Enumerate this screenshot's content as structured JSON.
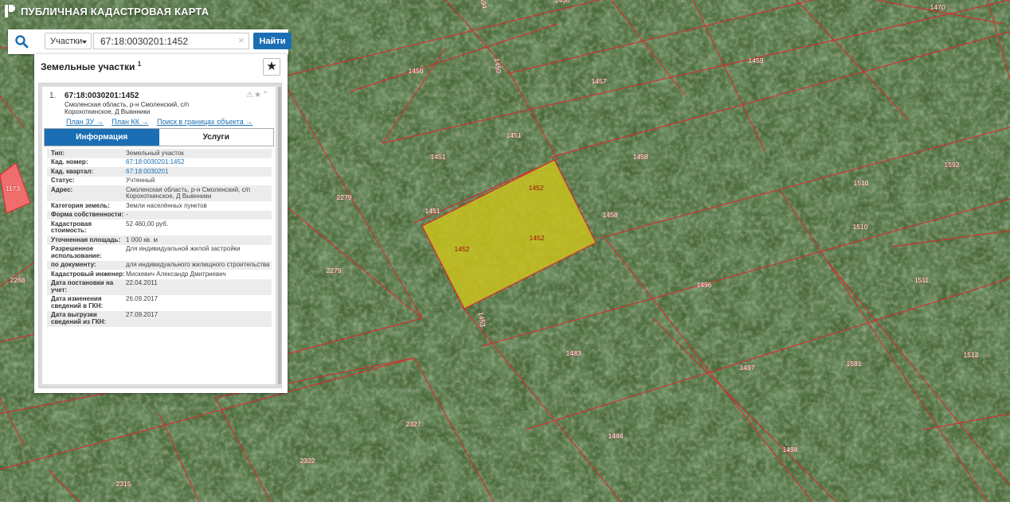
{
  "header": {
    "title": "ПУБЛИЧНАЯ КАДАСТРОВАЯ КАРТА",
    "logo_icon": "pkk-logo-icon"
  },
  "search": {
    "icon": "search-icon",
    "category": "Участки",
    "value": "67:18:0030201:1452",
    "find_label": "Найти"
  },
  "panel": {
    "title": "Земельные участки",
    "count": "1",
    "bookmark_icon": "star-icon",
    "result": {
      "index": "1.",
      "cad_number": "67:18:0030201:1452",
      "address": "Смоленская область, р-н Смоленский, с/п Корохоткинское, Д Вывнники",
      "links": [
        "План ЗУ →",
        "План КК →",
        "Поиск в границах объекта →"
      ],
      "tabs": [
        "Информация",
        "Услуги"
      ],
      "attributes": [
        {
          "key": "Тип:",
          "value": "Земельный участок"
        },
        {
          "key": "Кад. номер:",
          "value": "67:18:0030201:1452",
          "link": true
        },
        {
          "key": "Кад. квартал:",
          "value": "67:18:0030201",
          "link": true
        },
        {
          "key": "Статус:",
          "value": "Учтенный"
        },
        {
          "key": "Адрес:",
          "value": "Смоленская область, р-н Смоленский, с/п Корохоткинское, Д Вывнники"
        },
        {
          "key": "Категория земель:",
          "value": "Земли населённых пунктов"
        },
        {
          "key": "Форма собственности:",
          "value": "-"
        },
        {
          "key": "Кадастровая стоимость:",
          "value": "52 460,00 руб."
        },
        {
          "key": "Уточненная площадь:",
          "value": "1 000 кв. м"
        },
        {
          "key": "Разрешенное использование:",
          "value": "Для индивидуальной жилой застройки"
        },
        {
          "key": "по документу:",
          "value": "для индивидуального жилищного строительства"
        },
        {
          "key": "Кадастровый инженер:",
          "value": "Мискевич Александр Дмитриевич"
        },
        {
          "key": "Дата постановки на учет:",
          "value": "22.04.2011"
        },
        {
          "key": "Дата изменения сведений в ГКН:",
          "value": "26.09.2017"
        },
        {
          "key": "Дата выгрузки сведений из ГКН:",
          "value": "27.09.2017"
        }
      ]
    }
  },
  "map": {
    "parcel_labels": [
      "1456",
      "1470",
      "1450",
      "1450",
      "1457",
      "1459",
      "1451",
      "1451",
      "1458",
      "1592",
      "1510",
      "1510",
      "1452",
      "1452",
      "1452",
      "1451",
      "1458",
      "2279",
      "2279",
      "1453",
      "1496",
      "1511",
      "1594",
      "1483",
      "1497",
      "1591",
      "1512",
      "2327",
      "1484",
      "1498",
      "2322",
      "2315",
      "2268",
      "1173"
    ],
    "colors": {
      "boundary": "#e0262a",
      "selected_fill": "#c8c21e",
      "imagery": "#4b6a3a"
    }
  }
}
